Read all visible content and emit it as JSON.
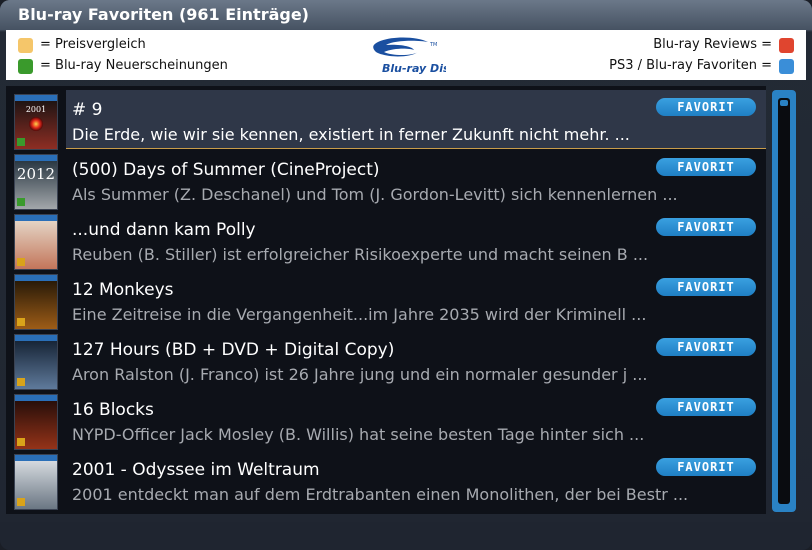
{
  "window": {
    "title": "Blu-ray Favoriten (961 Einträge)"
  },
  "legend": {
    "left": [
      {
        "color": "#f5c66a",
        "label": "= Preisvergleich"
      },
      {
        "color": "#3a9a2c",
        "label": "= Blu-ray Neuerscheinungen"
      }
    ],
    "right": [
      {
        "color": "#e0452f",
        "label": "Blu-ray Reviews ="
      },
      {
        "color": "#3a8ed8",
        "label": "PS3 / Blu-ray Favoriten ="
      }
    ],
    "logo_text": "Blu-ray Disc",
    "logo_tm": "TM"
  },
  "items": [
    {
      "title": "# 9",
      "desc": "Die Erde, wie wir sie kennen, existiert in ferner Zukunft nicht mehr.  ...",
      "badge": "FAVORIT",
      "selected": true
    },
    {
      "title": "(500) Days of Summer (CineProject)",
      "desc": "Als Summer (Z. Deschanel) und Tom (J. Gordon-Levitt) sich kennenlernen ...",
      "badge": "FAVORIT"
    },
    {
      "title": "...und dann kam Polly",
      "desc": "Reuben (B. Stiller) ist erfolgreicher Risikoexperte und macht seinen B ...",
      "badge": "FAVORIT"
    },
    {
      "title": "12 Monkeys",
      "desc": "Eine Zeitreise in die Vergangenheit...im Jahre 2035 wird der Kriminell ...",
      "badge": "FAVORIT"
    },
    {
      "title": "127 Hours (BD + DVD + Digital Copy)",
      "desc": "Aron Ralston (J. Franco) ist 26 Jahre jung und ein normaler gesunder j ...",
      "badge": "FAVORIT"
    },
    {
      "title": "16 Blocks",
      "desc": "NYPD-Officer Jack Mosley (B. Willis) hat seine besten Tage hinter sich ...",
      "badge": "FAVORIT"
    },
    {
      "title": "2001 - Odyssee im Weltraum",
      "desc": "2001 entdeckt man auf dem Erdtrabanten einen Monolithen, der bei Bestr ...",
      "badge": "FAVORIT"
    }
  ],
  "thumbs": [
    {
      "caption": "2001",
      "bg": "#111111",
      "accent": "#c0392b"
    },
    {
      "caption": "2012",
      "bg": "#1b2a36",
      "accent": "#d9d9d9"
    },
    {
      "caption": "",
      "bg": "#e8e0d2",
      "accent": "#b44a2a"
    },
    {
      "caption": "",
      "bg": "#1a1206",
      "accent": "#d27a1e"
    },
    {
      "caption": "",
      "bg": "#0e1a2a",
      "accent": "#7fa0c8"
    },
    {
      "caption": "",
      "bg": "#1a0a08",
      "accent": "#c6431f"
    },
    {
      "caption": "",
      "bg": "#e2e6ea",
      "accent": "#3b4a5a"
    }
  ]
}
